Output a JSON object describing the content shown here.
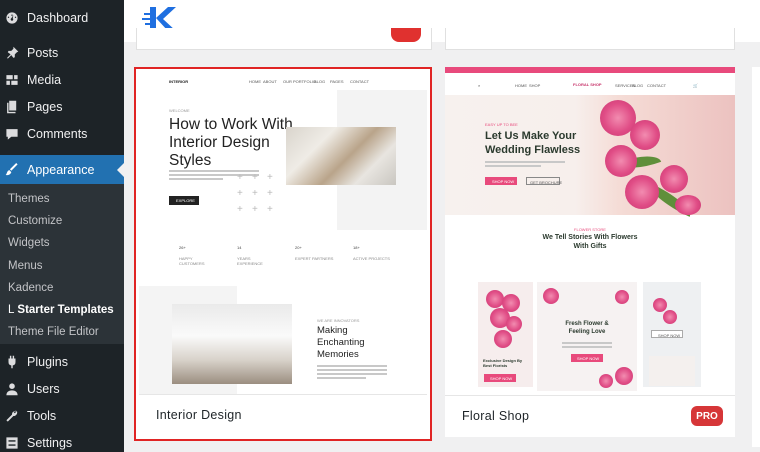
{
  "sidebar": {
    "items": [
      {
        "label": "Dashboard",
        "icon": "dashboard-icon"
      },
      {
        "label": "Posts",
        "icon": "pin-icon"
      },
      {
        "label": "Media",
        "icon": "media-icon"
      },
      {
        "label": "Pages",
        "icon": "pages-icon"
      },
      {
        "label": "Comments",
        "icon": "comment-icon"
      },
      {
        "label": "Appearance",
        "icon": "brush-icon",
        "active": true
      },
      {
        "label": "Plugins",
        "icon": "plugin-icon"
      },
      {
        "label": "Users",
        "icon": "user-icon"
      },
      {
        "label": "Tools",
        "icon": "wrench-icon"
      },
      {
        "label": "Settings",
        "icon": "settings-icon"
      }
    ],
    "submenu": [
      {
        "label": "Themes"
      },
      {
        "label": "Customize"
      },
      {
        "label": "Widgets"
      },
      {
        "label": "Menus"
      },
      {
        "label": "Kadence"
      },
      {
        "label": "Starter Templates",
        "current": true,
        "prefix": "L"
      },
      {
        "label": "Theme File Editor"
      }
    ]
  },
  "colors": {
    "sidebar_bg": "#1d2327",
    "active_bg": "#2271b1",
    "selection": "#e02424",
    "pro_badge": "#d63638",
    "floral_accent": "#e84a7c"
  },
  "templates": [
    {
      "title": "Interior Design",
      "selected": true,
      "preview": {
        "logo": "INTERIOR",
        "nav": [
          "HOME",
          "ABOUT",
          "OUR PORTFOLIO",
          "BLOG",
          "PAGES",
          "CONTACT"
        ],
        "eyebrow": "WELCOME",
        "heading": "How to Work With Interior Design Styles",
        "button": "EXPLORE",
        "stats": [
          {
            "num": "26+",
            "label": "HAPPY CUSTOMERS"
          },
          {
            "num": "14",
            "label": "YEARS EXPERIENCE"
          },
          {
            "num": "20+",
            "label": "EXPERT PARTNERS"
          },
          {
            "num": "18+",
            "label": "ACTIVE PROJECTS"
          }
        ],
        "eyebrow2": "WE ARE INNOVATORS",
        "heading2": "Making Enchanting Memories"
      }
    },
    {
      "title": "Floral Shop",
      "badge": "PRO",
      "preview": {
        "logo": "FLORAL SHOP",
        "nav": [
          "HOME",
          "SHOP",
          "SERVICES",
          "BLOG",
          "CONTACT"
        ],
        "eyebrow": "EASY UP TO BEE",
        "heading": "Let Us Make Your Wedding Flawless",
        "buttons": [
          "SHOP NOW",
          "GET BROCHURE"
        ],
        "section_eyebrow": "FLOWER STORE",
        "section_heading": "We Tell Stories With Flowers With Gifts",
        "tile_heading": "Fresh Flower & Feeling Love",
        "tile_text": "Exclusive Design By Best Florists",
        "tile_button": "SHOP NOW"
      }
    }
  ]
}
